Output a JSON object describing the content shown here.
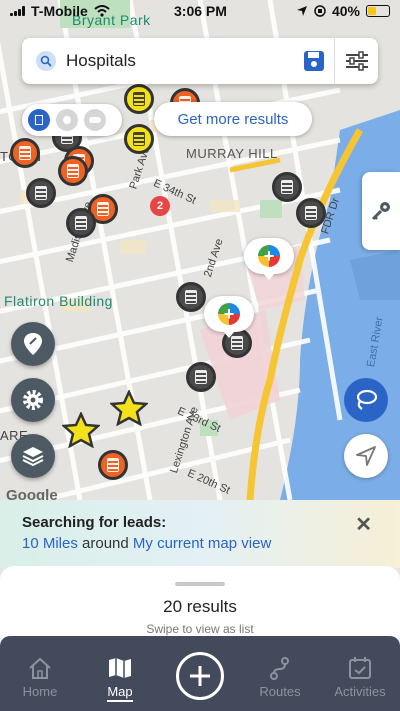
{
  "status_bar": {
    "carrier": "T-Mobile",
    "time": "3:06 PM",
    "battery": "40%"
  },
  "search": {
    "query": "Hospitals"
  },
  "map": {
    "more_results": "Get more results",
    "labels": {
      "bryant_park": "Bryant Park",
      "murray_hill": "MURRAY HILL",
      "flatiron": "Flatiron Building",
      "east_river": "East River",
      "fdr": "FDR Dr",
      "park_ave": "Park Ave",
      "e34": "E 34th St",
      "second_ave": "2nd Ave",
      "madison": "Madison Ave",
      "e23": "E 23rd St",
      "e20": "E 20th St",
      "lex": "Lexington Ave",
      "town": "TOWN",
      "are": "ARE"
    },
    "cluster_count": "2",
    "google": "Google"
  },
  "lead_panel": {
    "title": "Searching for leads:",
    "radius": "10 Miles",
    "around": "around",
    "location": "My current map view"
  },
  "results": {
    "count": "20 results",
    "hint": "Swipe to view as list"
  },
  "tabs": [
    {
      "label": "Home",
      "icon": "home-icon"
    },
    {
      "label": "Map",
      "icon": "map-icon"
    },
    {
      "label": "",
      "icon": "plus-icon"
    },
    {
      "label": "Routes",
      "icon": "routes-icon"
    },
    {
      "label": "Activities",
      "icon": "activities-icon"
    }
  ],
  "colors": {
    "accent": "#2a64c6",
    "tabbar": "#434a5b",
    "pin_orange": "#ee6224",
    "pin_yellow": "#f3e21a",
    "pin_gray": "#4a4a4a"
  }
}
